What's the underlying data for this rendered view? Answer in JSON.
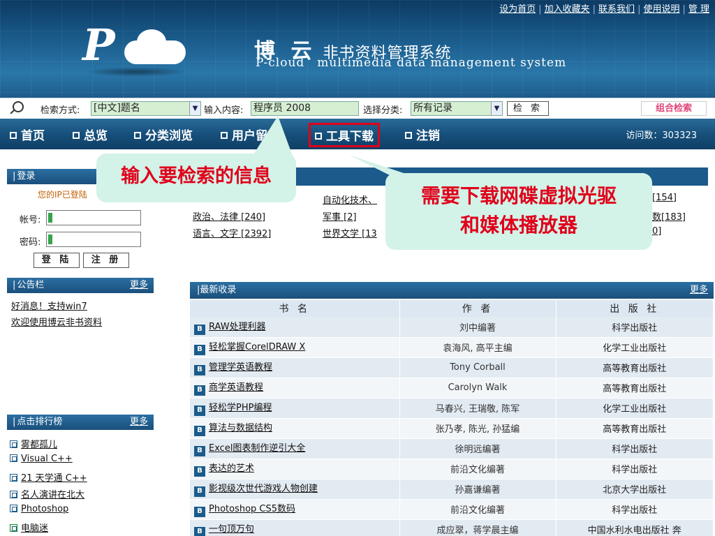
{
  "header": {
    "top_links": [
      "设为首页",
      "加入收藏夹",
      "联系我们",
      "使用说明",
      "管 理"
    ],
    "title_cn": "博 云",
    "title_sys": "非书资料管理系统",
    "title_en1": "P-cloud",
    "title_en2": "multimedia data management system"
  },
  "search": {
    "method_label": "检索方式:",
    "method_value": "[中文]题名",
    "input_label": "输入内容:",
    "input_value": "程序员 2008",
    "category_label": "选择分类:",
    "category_value": "所有记录",
    "search_button": "检 索",
    "combo_button": "组合检索"
  },
  "nav": {
    "items": [
      "首页",
      "总览",
      "分类浏览",
      "用户留言",
      "工具下载",
      "注销"
    ],
    "visits": "访问数：303323"
  },
  "login": {
    "title": "登录",
    "ip_note": "您的IP已登陆",
    "account_label": "帐号:",
    "password_label": "密码:",
    "login_button": "登 陆",
    "register_button": "注 册"
  },
  "notice": {
    "title": "公告栏",
    "more": "更多",
    "items": [
      "好消息！支持win7",
      "欢迎使用博云非书资料"
    ]
  },
  "ranking": {
    "title": "点击排行榜",
    "more": "更多",
    "items": [
      "雾都孤儿",
      "Visual C++",
      "21 天学通  C++",
      "名人演讲在北大",
      "Photoshop",
      "电脑迷"
    ]
  },
  "categories": {
    "items": [
      "自动化技术、",
      "政治、法律  [240]",
      "军事  [2]",
      "语言、文字  [2392]",
      "世界文学  [13",
      "[154]",
      "数[183]",
      "0]"
    ]
  },
  "latest": {
    "title": "最新收录",
    "more": "更多",
    "columns": [
      "书 名",
      "作 者",
      "出 版 社"
    ],
    "rows": [
      [
        "RAW处理利器",
        "刘中编著",
        "科学出版社"
      ],
      [
        "轻松掌握CorelDRAW X",
        "袁海风, 高平主编",
        "化学工业出版社"
      ],
      [
        "管理学英语教程",
        "Tony Corball",
        "高等教育出版社"
      ],
      [
        "商学英语教程",
        "Carolyn Walk",
        "高等教育出版社"
      ],
      [
        "轻松学PHP编程",
        "马春兴, 王瑞敬, 陈军",
        "化学工业出版社"
      ],
      [
        "算法与数据结构",
        "张乃孝, 陈光, 孙猛编",
        "高等教育出版社"
      ],
      [
        "Excel图表制作逆引大全",
        "徐明远编著",
        "科学出版社"
      ],
      [
        "表达的艺术",
        "前沿文化编著",
        "科学出版社"
      ],
      [
        "影视级次世代游戏人物创建",
        "孙嘉谦编著",
        "北京大学出版社"
      ],
      [
        "Photoshop CS5数码",
        "前沿文化编著",
        "科学出版社"
      ],
      [
        "一句顶万句",
        "成应翠，蒋学晨主编",
        "中国水利水电出版社 奔"
      ]
    ]
  },
  "callouts": {
    "search_hint": "输入要检索的信息",
    "download_hint_line1": "需要下载网碟虚拟光驱",
    "download_hint_line2": "和媒体播放器"
  },
  "colors": {
    "header_dark": "#0c3a63",
    "nav": "#17507c",
    "panel_head": "#1a4f7c",
    "callout_bg": "#d3f2e8",
    "callout_text": "#e0001a",
    "highlight_border": "#e0001a",
    "combo_text": "#e0457a"
  }
}
